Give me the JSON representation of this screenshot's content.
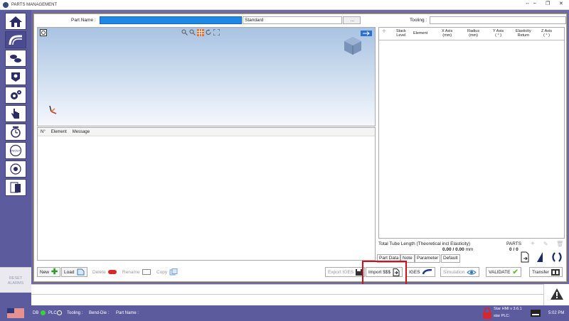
{
  "window": {
    "title": "PARTS MANAGEMENT",
    "controls": [
      "↔",
      "–",
      "❐",
      "✕"
    ]
  },
  "sidebar": {
    "items": [
      "home",
      "tube-bend",
      "parts",
      "tooling",
      "settings",
      "manual",
      "timer",
      "in-out",
      "counter",
      "report"
    ],
    "reset_label_1": "RESET",
    "reset_label_2": "ALARMS"
  },
  "header": {
    "part_name_label": "Part Name :",
    "part_name_value": "",
    "material_value": "Standard",
    "browse_label": "...",
    "tooling_label": "Tooling :",
    "tooling_value": ""
  },
  "message_panel": {
    "col_no": "N°",
    "col_element": "Element",
    "col_message": "Message"
  },
  "table": {
    "columns": [
      {
        "l1": "Stack",
        "l2": "Level"
      },
      {
        "l1": "Element",
        "l2": ""
      },
      {
        "l1": "X Axis",
        "l2": "(mm)"
      },
      {
        "l1": "Radius",
        "l2": "(mm)"
      },
      {
        "l1": "Y Axis",
        "l2": "( ° )"
      },
      {
        "l1": "Elasticity",
        "l2": "Return"
      },
      {
        "l1": "Z Axis",
        "l2": "( ° )"
      }
    ]
  },
  "totals": {
    "label": "Total Tube Length (Theoretical incl Elasticity)",
    "current": "0.00",
    "separator": "/",
    "max": "0.00",
    "unit": "mm",
    "parts_label": "PARTS",
    "parts_done": "0",
    "parts_sep": "/",
    "parts_total": "0"
  },
  "tabs": [
    "Part Data",
    "Note",
    "Parameter",
    "Default"
  ],
  "toolbar": {
    "new": "New",
    "load": "Load",
    "delete": "Delete",
    "rename": "Rename",
    "copy": "Copy",
    "export_iges": "Export IGES",
    "import_sss": "Import $$$",
    "iges": "IGES",
    "simulation": "Simulation",
    "validate": "VALIDATE",
    "transfer": "Transfer"
  },
  "status": {
    "db": "DB",
    "plc": "PLC",
    "tooling": "Tooling :",
    "bend_die": "Bend-Die :",
    "part_name": "Part Name :",
    "hmi": "Star HMI v 3.6.1",
    "star_plc": "star PLC:",
    "time": "5:02 PM"
  },
  "colors": {
    "accent": "#5b5b9e",
    "highlight": "#d0101a",
    "field_blue": "#1e88e5"
  }
}
